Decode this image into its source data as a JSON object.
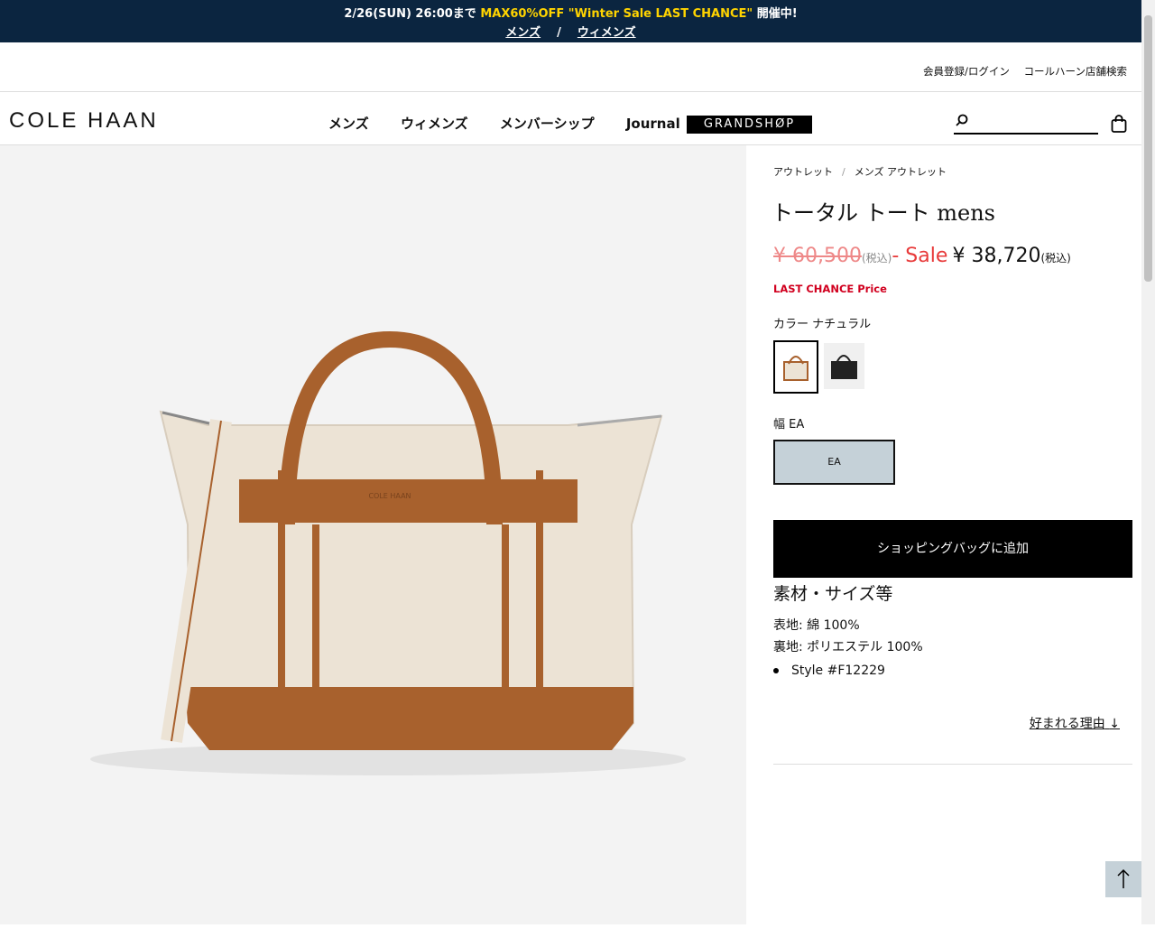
{
  "promo": {
    "date": "2/26(SUN) 26:00まで ",
    "highlight": "MAX60%OFF \"Winter Sale LAST CHANCE\"",
    "suffix": " 開催中!",
    "link_men": "メンズ",
    "separator": "/",
    "link_women": "ウィメンズ"
  },
  "util": {
    "login": "会員登録/ログイン",
    "store_search": "コールハーン店舗検索"
  },
  "header": {
    "logo": "COLE HAAN",
    "nav": [
      "メンズ",
      "ウィメンズ",
      "メンバーシップ",
      "Journal"
    ],
    "grandshop": "GRANDSHØP",
    "icons": {
      "search": "search-icon",
      "bag": "shopping-bag-icon"
    }
  },
  "breadcrumb": [
    "アウトレット",
    "メンズ アウトレット"
  ],
  "product": {
    "title": "トータル トート mens",
    "original_price": "¥ 60,500",
    "tax_label": "(税込)",
    "sale_prefix": "- ",
    "sale_label": "Sale",
    "sale_price": "¥ 38,720",
    "tax_label_2": "(税込)",
    "last_chance": "LAST CHANCE Price",
    "color_label": "カラー ナチュラル",
    "width_label": "幅 EA",
    "width_option": "EA",
    "add_to_bag": "ショッピングバッグに追加",
    "materials_heading": "素材・サイズ等",
    "material_outer": "表地: 綿 100%",
    "material_lining": "裏地: ポリエステル 100%",
    "style_number": "Style #F12229",
    "reasons_link": "好まれる理由",
    "reasons_arrow": "↓"
  },
  "colors": {
    "bag_canvas": "#ece3d5",
    "bag_leather": "#a8612d",
    "promo_bg": "#0b2540",
    "promo_highlight": "#ffd400",
    "sale_red": "#e83a3a",
    "width_selected_bg": "#c5d1d8"
  }
}
